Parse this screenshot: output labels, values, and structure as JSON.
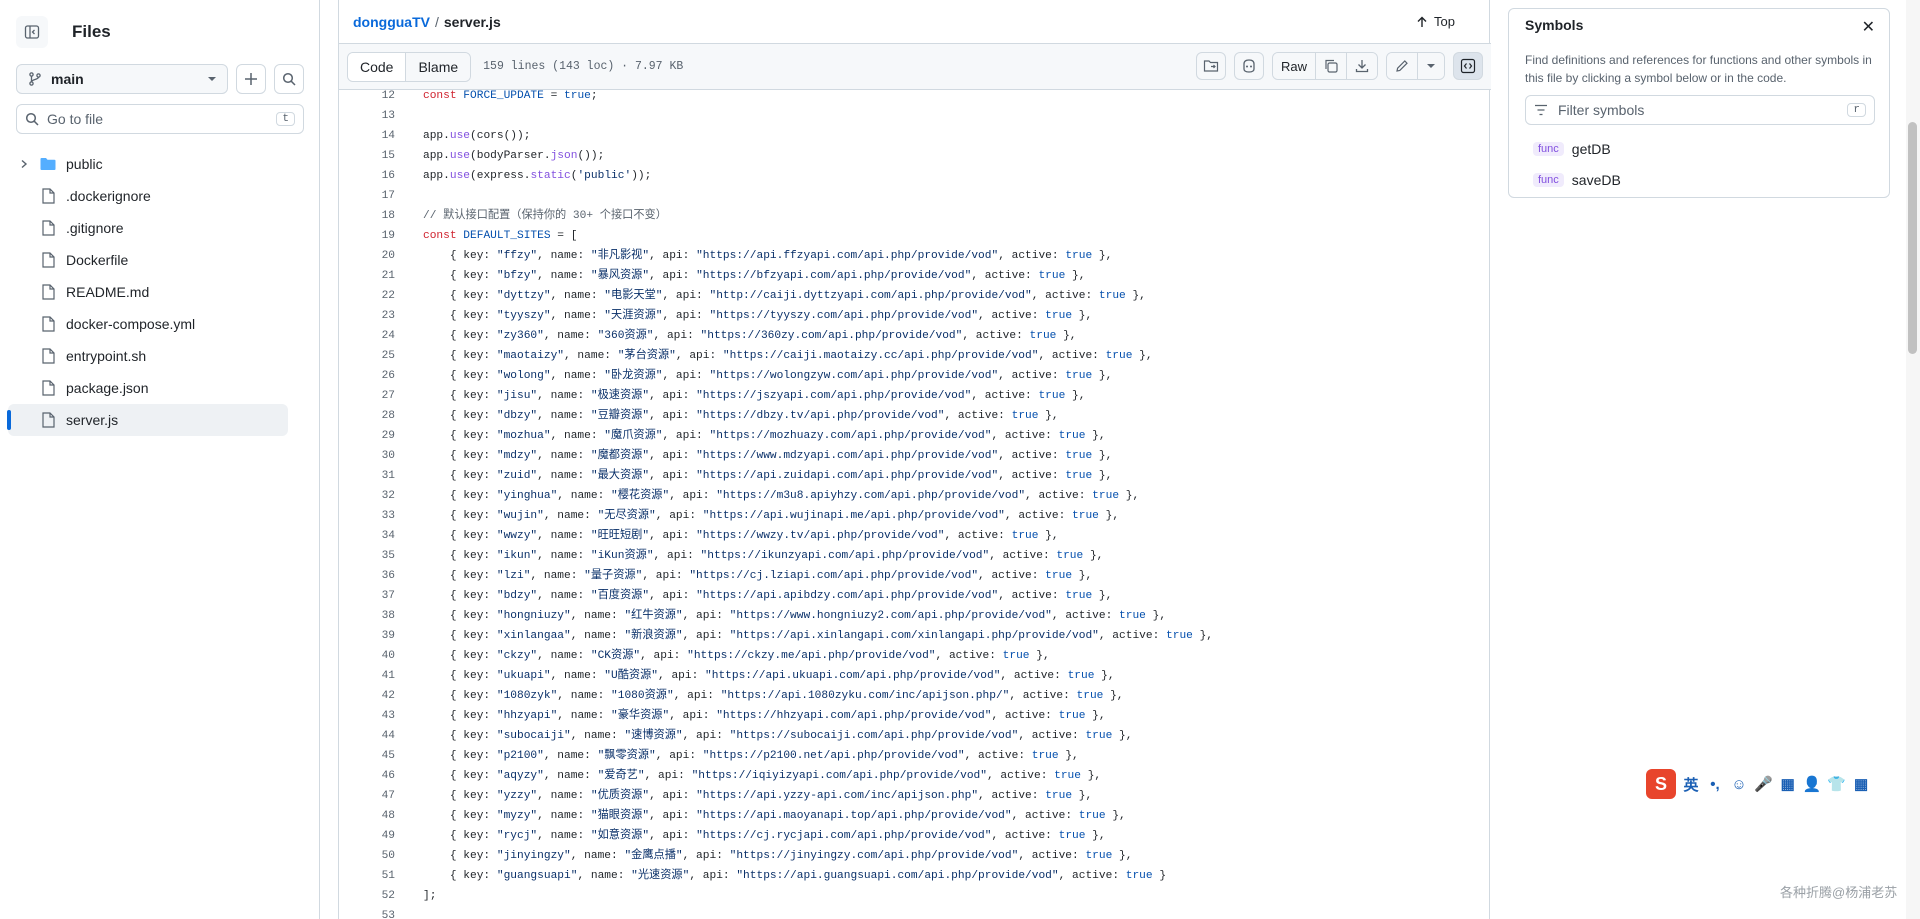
{
  "sidebar": {
    "title": "Files",
    "branch": "main",
    "goto_placeholder": "Go to file",
    "goto_shortcut": "t",
    "items": [
      {
        "name": "public",
        "type": "folder"
      },
      {
        "name": ".dockerignore",
        "type": "file"
      },
      {
        "name": ".gitignore",
        "type": "file"
      },
      {
        "name": "Dockerfile",
        "type": "file"
      },
      {
        "name": "README.md",
        "type": "file"
      },
      {
        "name": "docker-compose.yml",
        "type": "file"
      },
      {
        "name": "entrypoint.sh",
        "type": "file"
      },
      {
        "name": "package.json",
        "type": "file"
      },
      {
        "name": "server.js",
        "type": "file",
        "active": true
      }
    ]
  },
  "header": {
    "repo": "dongguaTV",
    "separator": "/",
    "file": "server.js",
    "top_label": "Top"
  },
  "toolbar": {
    "code_tab": "Code",
    "blame_tab": "Blame",
    "file_meta": "159 lines (143 loc) · 7.97 KB",
    "raw_label": "Raw"
  },
  "code": {
    "lines": [
      {
        "n": "12",
        "t": "const FORCE_UPDATE = true;"
      },
      {
        "n": "13",
        "t": ""
      },
      {
        "n": "14",
        "t": "app.use(cors());"
      },
      {
        "n": "15",
        "t": "app.use(bodyParser.json());"
      },
      {
        "n": "16",
        "t": "app.use(express.static('public'));"
      },
      {
        "n": "17",
        "t": ""
      },
      {
        "n": "18",
        "t": "// 默认接口配置（保持你的 30+ 个接口不变）"
      },
      {
        "n": "19",
        "t": "const DEFAULT_SITES = ["
      },
      {
        "n": "20",
        "t": "    { key: \"ffzy\", name: \"非凡影视\", api: \"https://api.ffzyapi.com/api.php/provide/vod\", active: true },"
      },
      {
        "n": "21",
        "t": "    { key: \"bfzy\", name: \"暴风资源\", api: \"https://bfzyapi.com/api.php/provide/vod\", active: true },"
      },
      {
        "n": "22",
        "t": "    { key: \"dyttzy\", name: \"电影天堂\", api: \"http://caiji.dyttzyapi.com/api.php/provide/vod\", active: true },"
      },
      {
        "n": "23",
        "t": "    { key: \"tyyszy\", name: \"天涯资源\", api: \"https://tyyszy.com/api.php/provide/vod\", active: true },"
      },
      {
        "n": "24",
        "t": "    { key: \"zy360\", name: \"360资源\", api: \"https://360zy.com/api.php/provide/vod\", active: true },"
      },
      {
        "n": "25",
        "t": "    { key: \"maotaizy\", name: \"茅台资源\", api: \"https://caiji.maotaizy.cc/api.php/provide/vod\", active: true },"
      },
      {
        "n": "26",
        "t": "    { key: \"wolong\", name: \"卧龙资源\", api: \"https://wolongzyw.com/api.php/provide/vod\", active: true },"
      },
      {
        "n": "27",
        "t": "    { key: \"jisu\", name: \"极速资源\", api: \"https://jszyapi.com/api.php/provide/vod\", active: true },"
      },
      {
        "n": "28",
        "t": "    { key: \"dbzy\", name: \"豆瓣资源\", api: \"https://dbzy.tv/api.php/provide/vod\", active: true },"
      },
      {
        "n": "29",
        "t": "    { key: \"mozhua\", name: \"魔爪资源\", api: \"https://mozhuazy.com/api.php/provide/vod\", active: true },"
      },
      {
        "n": "30",
        "t": "    { key: \"mdzy\", name: \"魔都资源\", api: \"https://www.mdzyapi.com/api.php/provide/vod\", active: true },"
      },
      {
        "n": "31",
        "t": "    { key: \"zuid\", name: \"最大资源\", api: \"https://api.zuidapi.com/api.php/provide/vod\", active: true },"
      },
      {
        "n": "32",
        "t": "    { key: \"yinghua\", name: \"樱花资源\", api: \"https://m3u8.apiyhzy.com/api.php/provide/vod\", active: true },"
      },
      {
        "n": "33",
        "t": "    { key: \"wujin\", name: \"无尽资源\", api: \"https://api.wujinapi.me/api.php/provide/vod\", active: true },"
      },
      {
        "n": "34",
        "t": "    { key: \"wwzy\", name: \"旺旺短剧\", api: \"https://wwzy.tv/api.php/provide/vod\", active: true },"
      },
      {
        "n": "35",
        "t": "    { key: \"ikun\", name: \"iKun资源\", api: \"https://ikunzyapi.com/api.php/provide/vod\", active: true },"
      },
      {
        "n": "36",
        "t": "    { key: \"lzi\", name: \"量子资源\", api: \"https://cj.lziapi.com/api.php/provide/vod\", active: true },"
      },
      {
        "n": "37",
        "t": "    { key: \"bdzy\", name: \"百度资源\", api: \"https://api.apibdzy.com/api.php/provide/vod\", active: true },"
      },
      {
        "n": "38",
        "t": "    { key: \"hongniuzy\", name: \"红牛资源\", api: \"https://www.hongniuzy2.com/api.php/provide/vod\", active: true },"
      },
      {
        "n": "39",
        "t": "    { key: \"xinlangaa\", name: \"新浪资源\", api: \"https://api.xinlangapi.com/xinlangapi.php/provide/vod\", active: true },"
      },
      {
        "n": "40",
        "t": "    { key: \"ckzy\", name: \"CK资源\", api: \"https://ckzy.me/api.php/provide/vod\", active: true },"
      },
      {
        "n": "41",
        "t": "    { key: \"ukuapi\", name: \"U酷资源\", api: \"https://api.ukuapi.com/api.php/provide/vod\", active: true },"
      },
      {
        "n": "42",
        "t": "    { key: \"1080zyk\", name: \"1080资源\", api: \"https://api.1080zyku.com/inc/apijson.php/\", active: true },"
      },
      {
        "n": "43",
        "t": "    { key: \"hhzyapi\", name: \"豪华资源\", api: \"https://hhzyapi.com/api.php/provide/vod\", active: true },"
      },
      {
        "n": "44",
        "t": "    { key: \"subocaiji\", name: \"速博资源\", api: \"https://subocaiji.com/api.php/provide/vod\", active: true },"
      },
      {
        "n": "45",
        "t": "    { key: \"p2100\", name: \"飘零资源\", api: \"https://p2100.net/api.php/provide/vod\", active: true },"
      },
      {
        "n": "46",
        "t": "    { key: \"aqyzy\", name: \"爱奇艺\", api: \"https://iqiyizyapi.com/api.php/provide/vod\", active: true },"
      },
      {
        "n": "47",
        "t": "    { key: \"yzzy\", name: \"优质资源\", api: \"https://api.yzzy-api.com/inc/apijson.php\", active: true },"
      },
      {
        "n": "48",
        "t": "    { key: \"myzy\", name: \"猫眼资源\", api: \"https://api.maoyanapi.top/api.php/provide/vod\", active: true },"
      },
      {
        "n": "49",
        "t": "    { key: \"rycj\", name: \"如意资源\", api: \"https://cj.rycjapi.com/api.php/provide/vod\", active: true },"
      },
      {
        "n": "50",
        "t": "    { key: \"jinyingzy\", name: \"金鹰点播\", api: \"https://jinyingzy.com/api.php/provide/vod\", active: true },"
      },
      {
        "n": "51",
        "t": "    { key: \"guangsuapi\", name: \"光速资源\", api: \"https://api.guangsuapi.com/api.php/provide/vod\", active: true }"
      },
      {
        "n": "52",
        "t": "];"
      },
      {
        "n": "53",
        "t": ""
      }
    ]
  },
  "symbols": {
    "title": "Symbols",
    "description": "Find definitions and references for functions and other symbols in this file by clicking a symbol below or in the code.",
    "filter_placeholder": "Filter symbols",
    "filter_shortcut": "r",
    "items": [
      {
        "kind": "func",
        "name": "getDB"
      },
      {
        "kind": "func",
        "name": "saveDB"
      }
    ]
  },
  "ime": {
    "cells": [
      "英",
      "•,",
      "☺",
      "🎤",
      "▦",
      "👤",
      "👕",
      "▦"
    ]
  },
  "watermark": "各种折腾@杨浦老苏",
  "colors": {
    "accent": "#0969da",
    "keyword": "#cf222e",
    "constant": "#0550ae",
    "string": "#0a3069",
    "function": "#8250df"
  }
}
